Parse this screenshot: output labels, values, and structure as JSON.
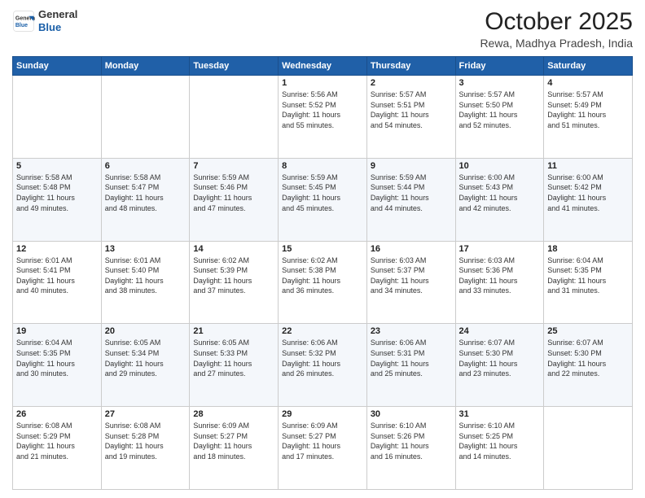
{
  "logo": {
    "general": "General",
    "blue": "Blue"
  },
  "header": {
    "month": "October 2025",
    "location": "Rewa, Madhya Pradesh, India"
  },
  "weekdays": [
    "Sunday",
    "Monday",
    "Tuesday",
    "Wednesday",
    "Thursday",
    "Friday",
    "Saturday"
  ],
  "rows": [
    [
      {
        "day": "",
        "info": ""
      },
      {
        "day": "",
        "info": ""
      },
      {
        "day": "",
        "info": ""
      },
      {
        "day": "1",
        "info": "Sunrise: 5:56 AM\nSunset: 5:52 PM\nDaylight: 11 hours\nand 55 minutes."
      },
      {
        "day": "2",
        "info": "Sunrise: 5:57 AM\nSunset: 5:51 PM\nDaylight: 11 hours\nand 54 minutes."
      },
      {
        "day": "3",
        "info": "Sunrise: 5:57 AM\nSunset: 5:50 PM\nDaylight: 11 hours\nand 52 minutes."
      },
      {
        "day": "4",
        "info": "Sunrise: 5:57 AM\nSunset: 5:49 PM\nDaylight: 11 hours\nand 51 minutes."
      }
    ],
    [
      {
        "day": "5",
        "info": "Sunrise: 5:58 AM\nSunset: 5:48 PM\nDaylight: 11 hours\nand 49 minutes."
      },
      {
        "day": "6",
        "info": "Sunrise: 5:58 AM\nSunset: 5:47 PM\nDaylight: 11 hours\nand 48 minutes."
      },
      {
        "day": "7",
        "info": "Sunrise: 5:59 AM\nSunset: 5:46 PM\nDaylight: 11 hours\nand 47 minutes."
      },
      {
        "day": "8",
        "info": "Sunrise: 5:59 AM\nSunset: 5:45 PM\nDaylight: 11 hours\nand 45 minutes."
      },
      {
        "day": "9",
        "info": "Sunrise: 5:59 AM\nSunset: 5:44 PM\nDaylight: 11 hours\nand 44 minutes."
      },
      {
        "day": "10",
        "info": "Sunrise: 6:00 AM\nSunset: 5:43 PM\nDaylight: 11 hours\nand 42 minutes."
      },
      {
        "day": "11",
        "info": "Sunrise: 6:00 AM\nSunset: 5:42 PM\nDaylight: 11 hours\nand 41 minutes."
      }
    ],
    [
      {
        "day": "12",
        "info": "Sunrise: 6:01 AM\nSunset: 5:41 PM\nDaylight: 11 hours\nand 40 minutes."
      },
      {
        "day": "13",
        "info": "Sunrise: 6:01 AM\nSunset: 5:40 PM\nDaylight: 11 hours\nand 38 minutes."
      },
      {
        "day": "14",
        "info": "Sunrise: 6:02 AM\nSunset: 5:39 PM\nDaylight: 11 hours\nand 37 minutes."
      },
      {
        "day": "15",
        "info": "Sunrise: 6:02 AM\nSunset: 5:38 PM\nDaylight: 11 hours\nand 36 minutes."
      },
      {
        "day": "16",
        "info": "Sunrise: 6:03 AM\nSunset: 5:37 PM\nDaylight: 11 hours\nand 34 minutes."
      },
      {
        "day": "17",
        "info": "Sunrise: 6:03 AM\nSunset: 5:36 PM\nDaylight: 11 hours\nand 33 minutes."
      },
      {
        "day": "18",
        "info": "Sunrise: 6:04 AM\nSunset: 5:35 PM\nDaylight: 11 hours\nand 31 minutes."
      }
    ],
    [
      {
        "day": "19",
        "info": "Sunrise: 6:04 AM\nSunset: 5:35 PM\nDaylight: 11 hours\nand 30 minutes."
      },
      {
        "day": "20",
        "info": "Sunrise: 6:05 AM\nSunset: 5:34 PM\nDaylight: 11 hours\nand 29 minutes."
      },
      {
        "day": "21",
        "info": "Sunrise: 6:05 AM\nSunset: 5:33 PM\nDaylight: 11 hours\nand 27 minutes."
      },
      {
        "day": "22",
        "info": "Sunrise: 6:06 AM\nSunset: 5:32 PM\nDaylight: 11 hours\nand 26 minutes."
      },
      {
        "day": "23",
        "info": "Sunrise: 6:06 AM\nSunset: 5:31 PM\nDaylight: 11 hours\nand 25 minutes."
      },
      {
        "day": "24",
        "info": "Sunrise: 6:07 AM\nSunset: 5:30 PM\nDaylight: 11 hours\nand 23 minutes."
      },
      {
        "day": "25",
        "info": "Sunrise: 6:07 AM\nSunset: 5:30 PM\nDaylight: 11 hours\nand 22 minutes."
      }
    ],
    [
      {
        "day": "26",
        "info": "Sunrise: 6:08 AM\nSunset: 5:29 PM\nDaylight: 11 hours\nand 21 minutes."
      },
      {
        "day": "27",
        "info": "Sunrise: 6:08 AM\nSunset: 5:28 PM\nDaylight: 11 hours\nand 19 minutes."
      },
      {
        "day": "28",
        "info": "Sunrise: 6:09 AM\nSunset: 5:27 PM\nDaylight: 11 hours\nand 18 minutes."
      },
      {
        "day": "29",
        "info": "Sunrise: 6:09 AM\nSunset: 5:27 PM\nDaylight: 11 hours\nand 17 minutes."
      },
      {
        "day": "30",
        "info": "Sunrise: 6:10 AM\nSunset: 5:26 PM\nDaylight: 11 hours\nand 16 minutes."
      },
      {
        "day": "31",
        "info": "Sunrise: 6:10 AM\nSunset: 5:25 PM\nDaylight: 11 hours\nand 14 minutes."
      },
      {
        "day": "",
        "info": ""
      }
    ]
  ]
}
